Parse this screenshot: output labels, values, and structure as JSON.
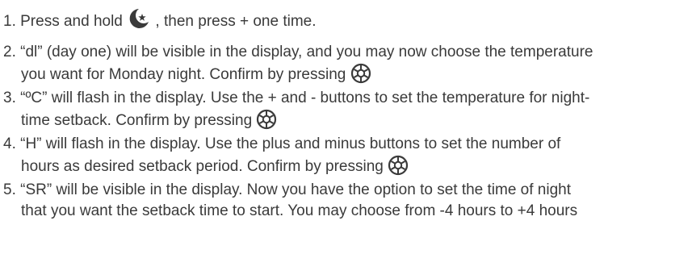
{
  "document": {
    "steps": [
      {
        "lines": [
          {
            "a": "1. Press and hold ",
            "b": " , then press + one time."
          }
        ]
      },
      {
        "lines": [
          {
            "a": "2. “dl” (day one) will be visible in the display, and you may now choose the temperature"
          },
          {
            "a": "you want for Monday night. Confirm by pressing "
          }
        ]
      },
      {
        "lines": [
          {
            "a": "3. “ºC” will flash in the display. Use the + and - buttons to set the temperature for night-"
          },
          {
            "a": "time setback. Confirm by pressing "
          }
        ]
      },
      {
        "lines": [
          {
            "a": "4. “H” will flash in the display. Use the plus and minus buttons to set the number of"
          },
          {
            "a": "hours as desired setback period. Confirm by pressing "
          }
        ]
      },
      {
        "lines": [
          {
            "a": "5. “SR” will be visible in the display. Now you have the option to set the time of night"
          },
          {
            "a": "that you want the setback time to start. You may choose from -4 hours to +4 hours"
          }
        ]
      }
    ],
    "icons": {
      "moon_star": "moon-star-icon",
      "confirm": "gear-confirm-icon"
    },
    "colors": {
      "text": "#3a3a3a",
      "icon": "#3a3a3a"
    }
  }
}
